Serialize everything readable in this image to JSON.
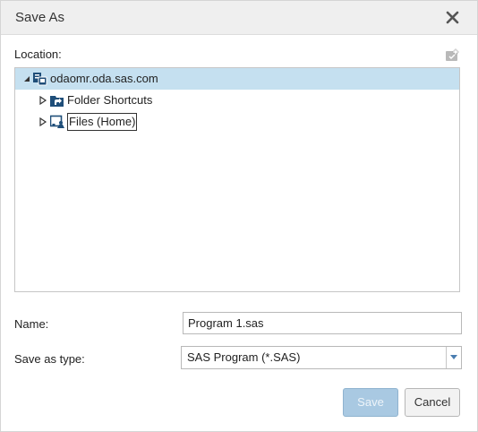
{
  "dialog": {
    "title": "Save As",
    "close_icon": "close-icon"
  },
  "location": {
    "label": "Location:",
    "new_folder_icon": "new-folder-icon"
  },
  "tree": {
    "items": [
      {
        "label": "odaomr.oda.sas.com",
        "icon": "server-icon",
        "expanded": true,
        "selected": true
      },
      {
        "label": "Folder Shortcuts",
        "icon": "folder-shortcut-icon",
        "expanded": false,
        "selected": false
      },
      {
        "label": "Files (Home)",
        "icon": "home-files-icon",
        "expanded": false,
        "selected": false,
        "focused": true
      }
    ]
  },
  "form": {
    "name_label": "Name:",
    "name_value": "Program 1.sas",
    "type_label": "Save as type:",
    "type_value": "SAS Program (*.SAS)"
  },
  "buttons": {
    "save_label": "Save",
    "cancel_label": "Cancel",
    "save_enabled": false
  },
  "colors": {
    "selection": "#c5e0f0",
    "primary_disabled": "#a9c9e2",
    "icon_navy": "#1f4e79"
  }
}
